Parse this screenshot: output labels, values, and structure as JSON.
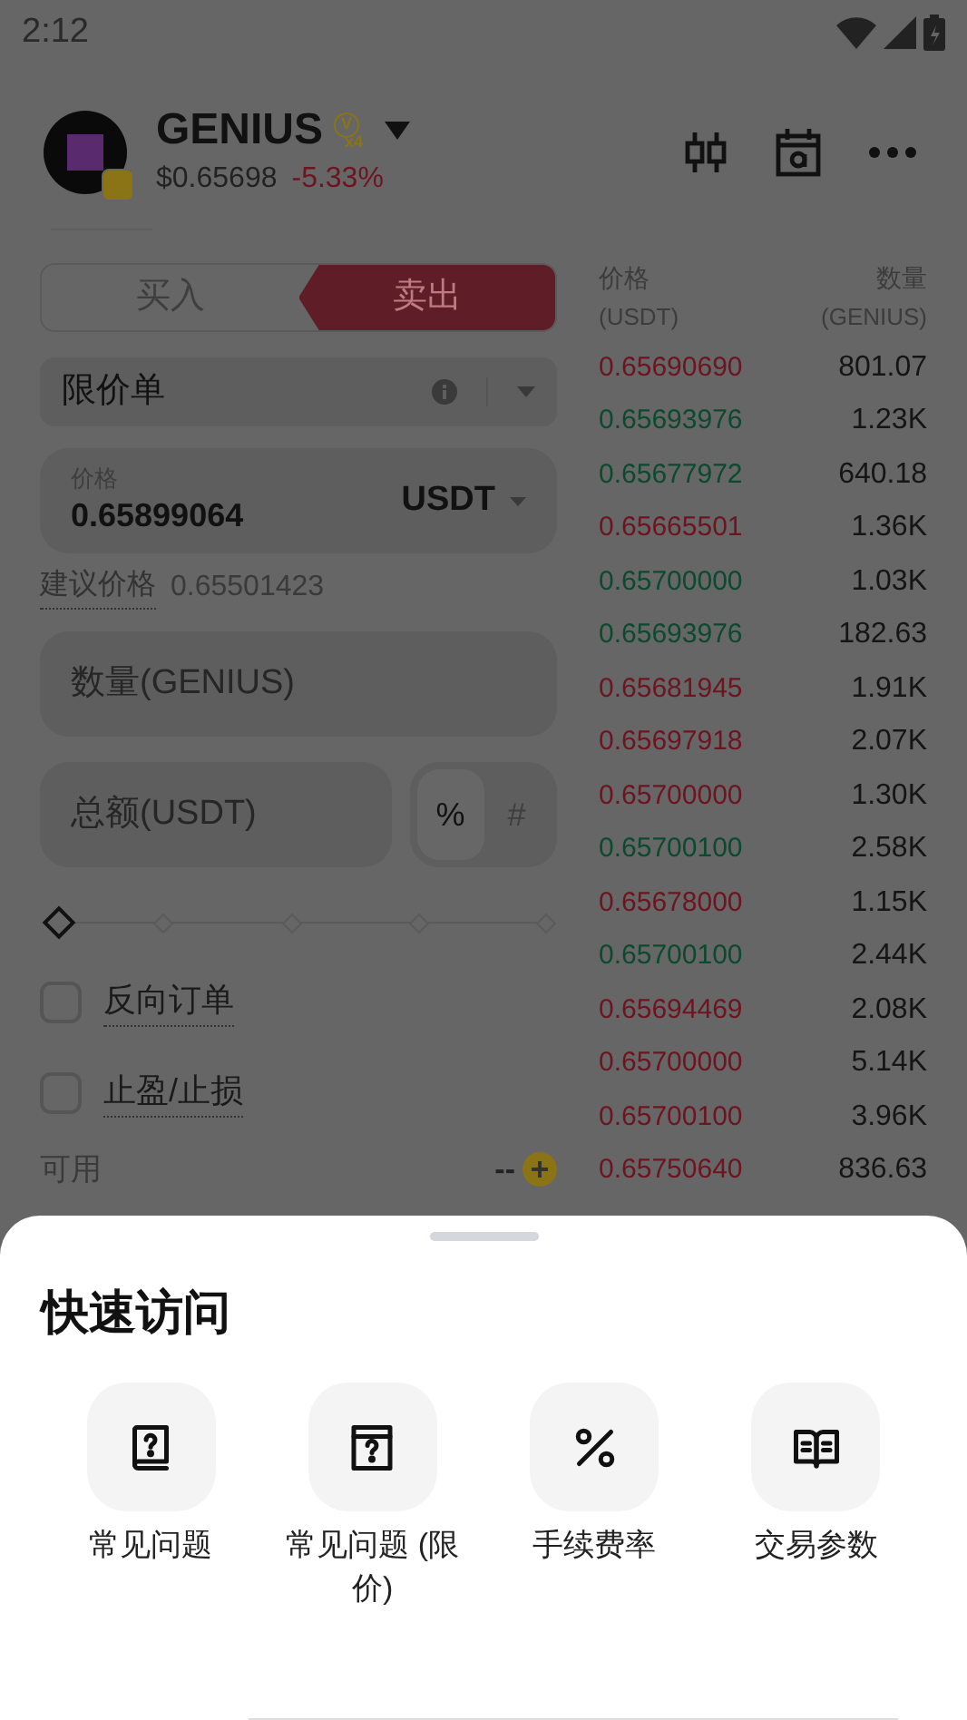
{
  "status_bar": {
    "time": "2:12"
  },
  "header": {
    "name": "GENIUS",
    "badge_letter": "V",
    "badge_text": "x4",
    "price": "$0.65698",
    "change": "-5.33%"
  },
  "trade_tabs": [
    {
      "label": "买入",
      "selected": false
    },
    {
      "label": "卖出",
      "selected": true
    }
  ],
  "order_type": {
    "label": "限价单"
  },
  "price_field": {
    "label": "价格",
    "value": "0.65899064",
    "unit": "USDT"
  },
  "suggested_price": {
    "label": "建议价格",
    "value": "0.65501423"
  },
  "quantity_field": {
    "placeholder": "数量(GENIUS)"
  },
  "total_field": {
    "placeholder": "总额(USDT)"
  },
  "total_modes": [
    {
      "label": "%",
      "selected": true
    },
    {
      "label": "#",
      "selected": false
    }
  ],
  "amount_slider": {
    "level": 0
  },
  "options": [
    {
      "label": "反向订单",
      "checked": false
    },
    {
      "label": "止盈/止损",
      "checked": false
    }
  ],
  "available": {
    "label": "可用",
    "value": "--"
  },
  "order_book": {
    "columns": [
      {
        "title": "价格",
        "unit": "(USDT)"
      },
      {
        "title": "数量",
        "unit": "(GENIUS)"
      }
    ],
    "rows": [
      {
        "color": "#6e1420",
        "price": "0.65690690",
        "amount": "801.07"
      },
      {
        "color": "#0b4a2e",
        "price": "0.65693976",
        "amount": "1.23K"
      },
      {
        "color": "#0b4a2e",
        "price": "0.65677972",
        "amount": "640.18"
      },
      {
        "color": "#6e1420",
        "price": "0.65665501",
        "amount": "1.36K"
      },
      {
        "color": "#0b4a2e",
        "price": "0.65700000",
        "amount": "1.03K"
      },
      {
        "color": "#0b4a2e",
        "price": "0.65693976",
        "amount": "182.63"
      },
      {
        "color": "#6e1420",
        "price": "0.65681945",
        "amount": "1.91K"
      },
      {
        "color": "#6e1420",
        "price": "0.65697918",
        "amount": "2.07K"
      },
      {
        "color": "#6e1420",
        "price": "0.65700000",
        "amount": "1.30K"
      },
      {
        "color": "#0b4a2e",
        "price": "0.65700100",
        "amount": "2.58K"
      },
      {
        "color": "#6e1420",
        "price": "0.65678000",
        "amount": "1.15K"
      },
      {
        "color": "#0b4a2e",
        "price": "0.65700100",
        "amount": "2.44K"
      },
      {
        "color": "#6e1420",
        "price": "0.65694469",
        "amount": "2.08K"
      },
      {
        "color": "#6e1420",
        "price": "0.65700000",
        "amount": "5.14K"
      },
      {
        "color": "#6e1420",
        "price": "0.65700100",
        "amount": "3.96K"
      },
      {
        "color": "#6e1420",
        "price": "0.65750640",
        "amount": "836.63"
      }
    ]
  },
  "quick_access": {
    "title": "快速访问",
    "items": [
      {
        "kind": "faq",
        "label": "常见问题"
      },
      {
        "kind": "faq_limit",
        "label": "常见问题 (限价)"
      },
      {
        "kind": "fee",
        "label": "手续费率"
      },
      {
        "kind": "params",
        "label": "交易参数"
      }
    ]
  }
}
